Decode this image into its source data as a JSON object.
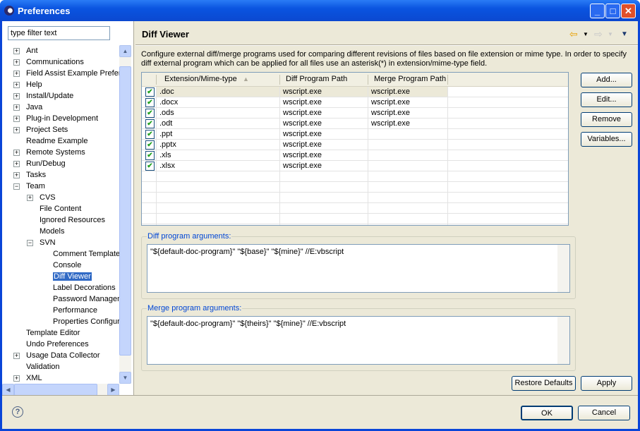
{
  "window": {
    "title": "Preferences",
    "controls": [
      "minimize",
      "maximize",
      "close"
    ]
  },
  "filter": {
    "placeholder": "type filter text"
  },
  "tree": [
    {
      "label": "Ant",
      "level": 0,
      "expander": "+"
    },
    {
      "label": "Communications",
      "level": 0,
      "expander": "+"
    },
    {
      "label": "Field Assist Example Preferences",
      "level": 0,
      "expander": "+"
    },
    {
      "label": "Help",
      "level": 0,
      "expander": "+"
    },
    {
      "label": "Install/Update",
      "level": 0,
      "expander": "+"
    },
    {
      "label": "Java",
      "level": 0,
      "expander": "+"
    },
    {
      "label": "Plug-in Development",
      "level": 0,
      "expander": "+"
    },
    {
      "label": "Project Sets",
      "level": 0,
      "expander": "+"
    },
    {
      "label": "Readme Example",
      "level": 0,
      "expander": ""
    },
    {
      "label": "Remote Systems",
      "level": 0,
      "expander": "+"
    },
    {
      "label": "Run/Debug",
      "level": 0,
      "expander": "+"
    },
    {
      "label": "Tasks",
      "level": 0,
      "expander": "+"
    },
    {
      "label": "Team",
      "level": 0,
      "expander": "-"
    },
    {
      "label": "CVS",
      "level": 1,
      "expander": "+"
    },
    {
      "label": "File Content",
      "level": 1,
      "expander": ""
    },
    {
      "label": "Ignored Resources",
      "level": 1,
      "expander": ""
    },
    {
      "label": "Models",
      "level": 1,
      "expander": ""
    },
    {
      "label": "SVN",
      "level": 1,
      "expander": "-"
    },
    {
      "label": "Comment Templates",
      "level": 2,
      "expander": ""
    },
    {
      "label": "Console",
      "level": 2,
      "expander": ""
    },
    {
      "label": "Diff Viewer",
      "level": 2,
      "expander": "",
      "selected": true
    },
    {
      "label": "Label Decorations",
      "level": 2,
      "expander": ""
    },
    {
      "label": "Password Management",
      "level": 2,
      "expander": ""
    },
    {
      "label": "Performance",
      "level": 2,
      "expander": ""
    },
    {
      "label": "Properties Configuration",
      "level": 2,
      "expander": ""
    },
    {
      "label": "Template Editor",
      "level": 0,
      "expander": ""
    },
    {
      "label": "Undo Preferences",
      "level": 0,
      "expander": ""
    },
    {
      "label": "Usage Data Collector",
      "level": 0,
      "expander": "+"
    },
    {
      "label": "Validation",
      "level": 0,
      "expander": ""
    },
    {
      "label": "XML",
      "level": 0,
      "expander": "+"
    }
  ],
  "page": {
    "title": "Diff Viewer",
    "description": "Configure external diff/merge programs used for comparing different revisions of files based on file extension or mime type. In order to specify diff external program which can be applied for all files use an asterisk(*) in extension/mime-type field.",
    "table": {
      "columns": [
        "Extension/Mime-type",
        "Diff Program Path",
        "Merge Program Path"
      ],
      "sort_icon": "sort-ascending",
      "rows": [
        {
          "checked": true,
          "ext": ".doc",
          "diff": "wscript.exe",
          "merge": "wscript.exe"
        },
        {
          "checked": true,
          "ext": ".docx",
          "diff": "wscript.exe",
          "merge": "wscript.exe"
        },
        {
          "checked": true,
          "ext": ".ods",
          "diff": "wscript.exe",
          "merge": "wscript.exe"
        },
        {
          "checked": true,
          "ext": ".odt",
          "diff": "wscript.exe",
          "merge": "wscript.exe"
        },
        {
          "checked": true,
          "ext": ".ppt",
          "diff": "wscript.exe",
          "merge": ""
        },
        {
          "checked": true,
          "ext": ".pptx",
          "diff": "wscript.exe",
          "merge": ""
        },
        {
          "checked": true,
          "ext": ".xls",
          "diff": "wscript.exe",
          "merge": ""
        },
        {
          "checked": true,
          "ext": ".xlsx",
          "diff": "wscript.exe",
          "merge": ""
        }
      ]
    },
    "buttons": {
      "add": "Add...",
      "edit": "Edit...",
      "remove": "Remove",
      "variables": "Variables..."
    },
    "diff_args": {
      "label": "Diff program arguments:",
      "value": "\"${default-doc-program}\" \"${base}\" \"${mine}\" //E:vbscript"
    },
    "merge_args": {
      "label": "Merge program arguments:",
      "value": "\"${default-doc-program}\" \"${theirs}\" \"${mine}\" //E:vbscript"
    },
    "restore_defaults": "Restore Defaults",
    "apply": "Apply"
  },
  "footer": {
    "ok": "OK",
    "cancel": "Cancel",
    "help": "?"
  }
}
